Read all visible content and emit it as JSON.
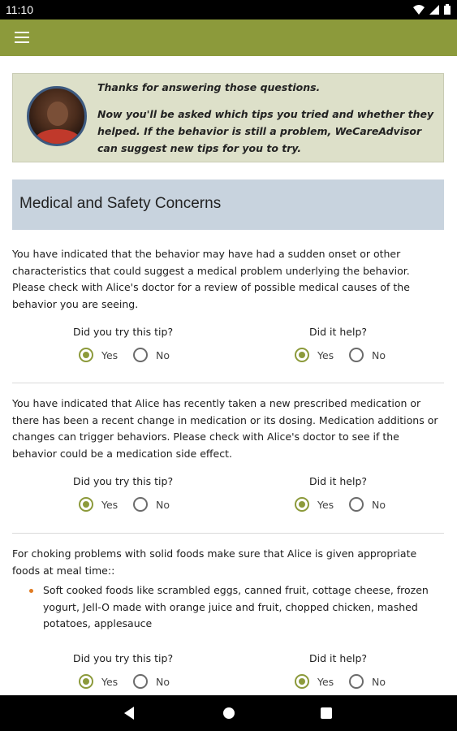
{
  "status_bar": {
    "time": "11:10"
  },
  "intro": {
    "line1": "Thanks for answering those questions.",
    "line2": "Now you'll be asked which tips you tried and whether they helped. If the behavior is still a problem, WeCareAdvisor can suggest new tips for you to try."
  },
  "section": {
    "title": "Medical and Safety Concerns"
  },
  "labels": {
    "tried": "Did you try this tip?",
    "helped": "Did it help?",
    "yes": "Yes",
    "no": "No"
  },
  "tips": [
    {
      "text": "You have indicated that the behavior may have had a sudden onset or other characteristics that could suggest a medical problem underlying the behavior. Please check with Alice's doctor for a review of possible medical causes of the behavior you are seeing.",
      "tried": "Yes",
      "helped": "Yes"
    },
    {
      "text": "You have indicated that Alice has recently taken a new prescribed medication or there has been a recent change in medication or its dosing. Medication additions or changes can trigger behaviors. Please check with Alice's doctor to see if the behavior could be a medication side effect.",
      "tried": "Yes",
      "helped": "Yes"
    },
    {
      "text": "For choking problems with solid foods make sure that Alice is given appropriate foods at meal time::",
      "bullet": "Soft cooked foods like scrambled eggs, canned fruit, cottage cheese, frozen yogurt, Jell-O made with orange juice and fruit, chopped chicken, mashed potatoes, applesauce",
      "tried": "Yes",
      "helped": "Yes"
    }
  ],
  "colors": {
    "appbar": "#8c9a3b",
    "intro_bg": "#dde0c9",
    "section_bg": "#c8d3de",
    "bullet": "#e07b22"
  }
}
